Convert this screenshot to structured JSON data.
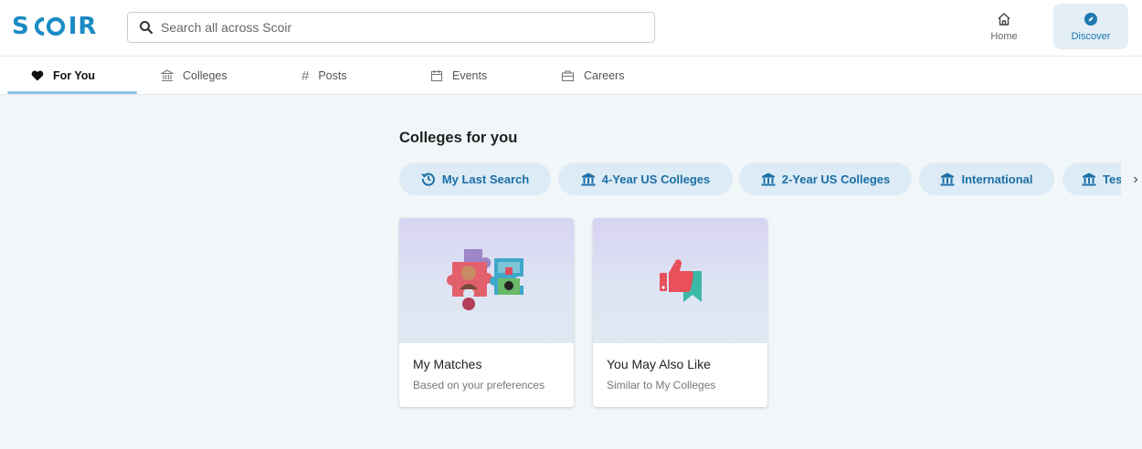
{
  "header": {
    "logo": "SCOIR",
    "search": {
      "placeholder": "Search all across Scoir",
      "value": ""
    },
    "nav": [
      {
        "label": "Home",
        "icon": "home-icon"
      },
      {
        "label": "Discover",
        "icon": "compass-icon",
        "active": true
      }
    ]
  },
  "tabs": [
    {
      "label": "For You",
      "icon": "heart-icon",
      "active": true
    },
    {
      "label": "Colleges",
      "icon": "college-icon"
    },
    {
      "label": "Posts",
      "icon": "hash-icon"
    },
    {
      "label": "Events",
      "icon": "calendar-icon"
    },
    {
      "label": "Careers",
      "icon": "briefcase-icon"
    }
  ],
  "main": {
    "section_title": "Colleges for you",
    "chips": [
      {
        "label": "My Last Search",
        "icon": "history-icon"
      },
      {
        "label": "4-Year US Colleges",
        "icon": "college-icon"
      },
      {
        "label": "2-Year US Colleges",
        "icon": "college-icon"
      },
      {
        "label": "International",
        "icon": "college-icon"
      },
      {
        "label": "Test Optional",
        "icon": "college-icon"
      }
    ],
    "cards": [
      {
        "title": "My Matches",
        "subtitle": "Based on your preferences",
        "icon": "puzzle-icon"
      },
      {
        "title": "You May Also Like",
        "subtitle": "Similar to My Colleges",
        "icon": "thumbs-up-icon"
      }
    ]
  },
  "colors": {
    "brand": "#1a8bc4",
    "chip_bg": "#dcebf5",
    "chip_text": "#1c6fa6",
    "page_bg": "#f1f6f9",
    "tab_underline": "#8bc3e4"
  }
}
